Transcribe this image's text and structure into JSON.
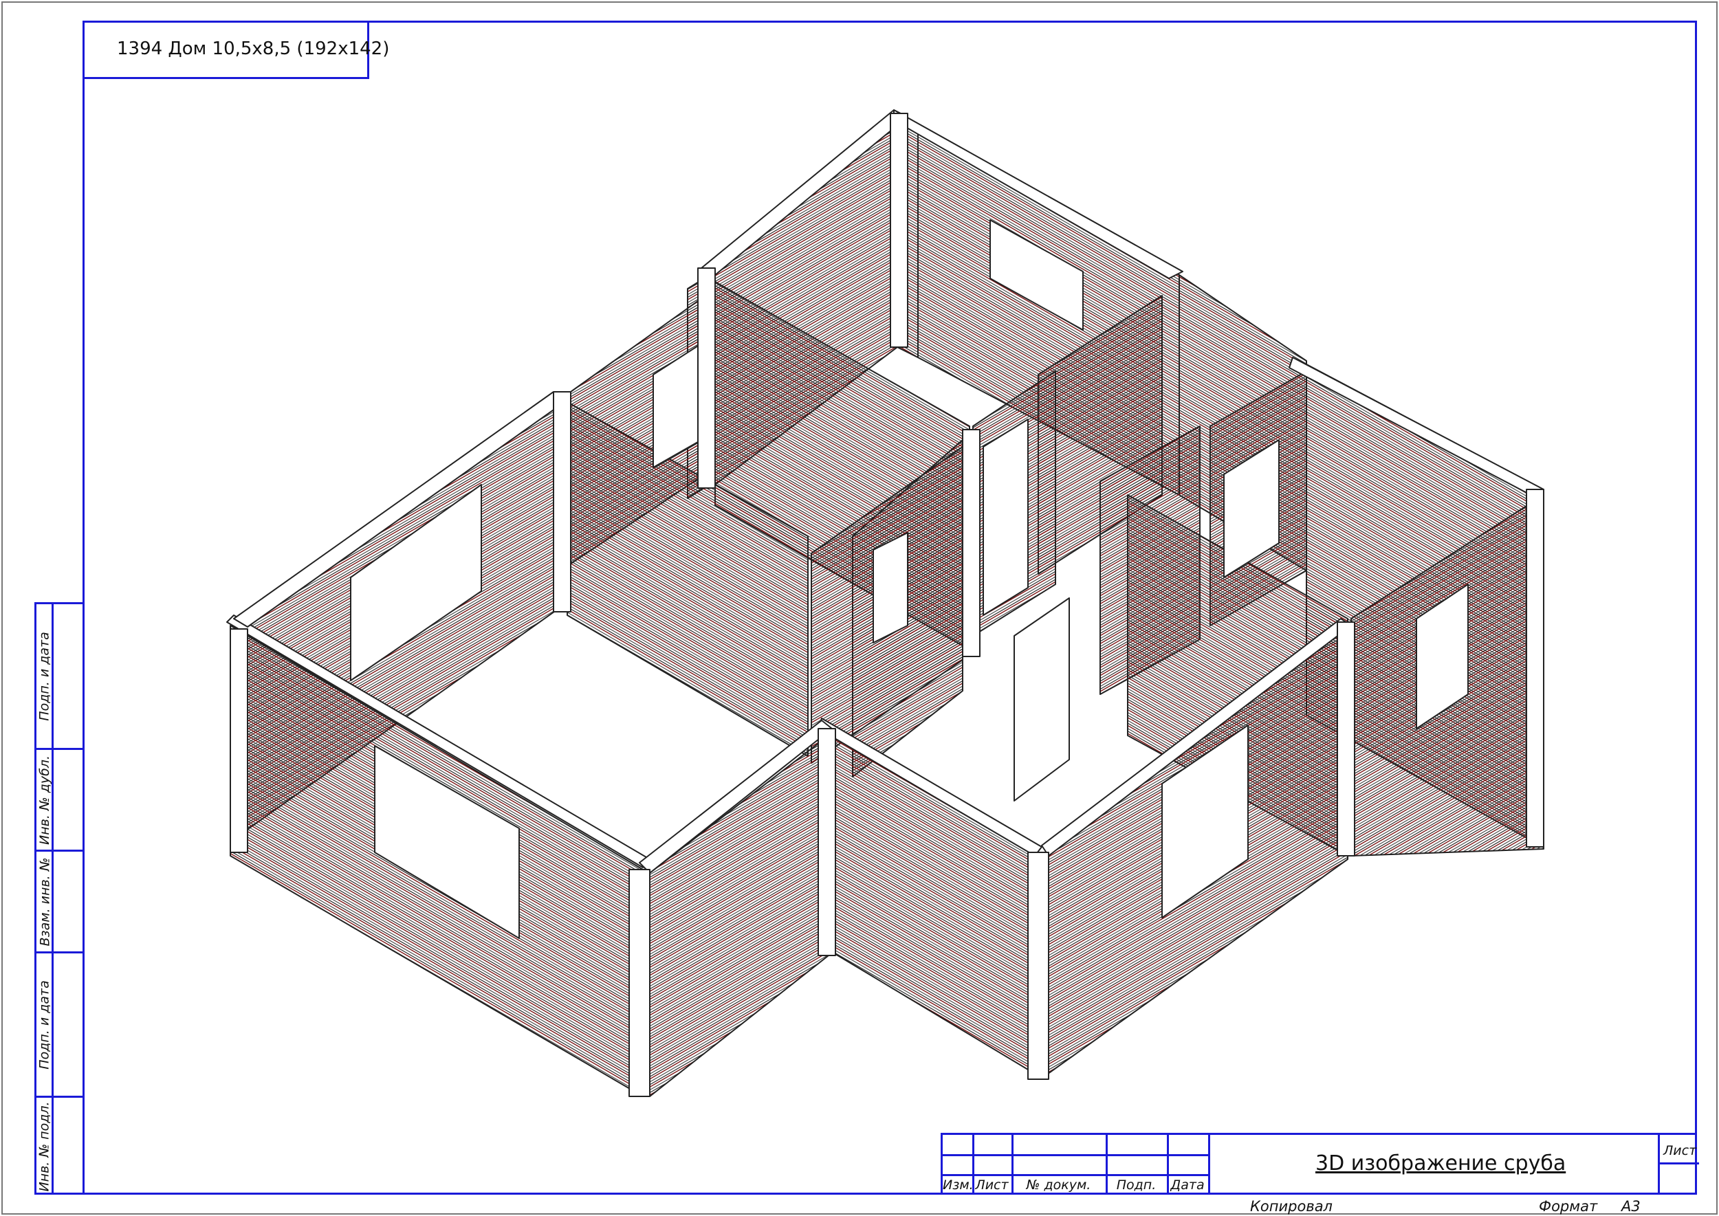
{
  "sheet": {
    "title": "1394  Дом 10,5х8,5 (192х142)",
    "drawing_name": "3D изображение сруба",
    "sheet_label": "Лист",
    "copied_label": "Копировал",
    "format_label": "Формат",
    "format_value": "А3"
  },
  "side_stamp": [
    "Подп. и дата",
    "Инв. № дубл.",
    "Взам. инв. №",
    "Подп. и дата",
    "Инв. № подл."
  ],
  "stamp_headers": [
    "Изм.",
    "Лист",
    "№ докум.",
    "Подп.",
    "Дата"
  ],
  "colors": {
    "frame": "#1a1ad8",
    "wall_line": "#7a1010",
    "outline": "#222222"
  }
}
